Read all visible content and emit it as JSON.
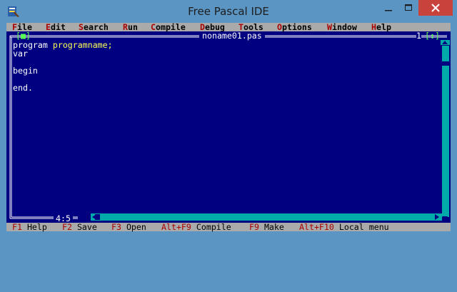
{
  "window": {
    "title": "Free Pascal IDE",
    "icon": "pascal-app-icon",
    "controls": [
      "minimize-icon",
      "maximize-icon",
      "close-icon"
    ],
    "accent_close": "#c7433b"
  },
  "menu": [
    {
      "hotkey": "F",
      "rest": "ile"
    },
    {
      "hotkey": "E",
      "rest": "dit"
    },
    {
      "hotkey": "S",
      "rest": "earch"
    },
    {
      "hotkey": "R",
      "rest": "un"
    },
    {
      "hotkey": "C",
      "rest": "ompile"
    },
    {
      "hotkey": "D",
      "rest": "ebug"
    },
    {
      "hotkey": "T",
      "rest": "ools"
    },
    {
      "hotkey": "O",
      "rest": "ptions"
    },
    {
      "hotkey": "W",
      "rest": "indow"
    },
    {
      "hotkey": "H",
      "rest": "elp"
    }
  ],
  "editor": {
    "filename": "noname01.pas",
    "window_number": "1",
    "close_box": "[■]",
    "zoom_box": "[↕]",
    "cursor_position": "4:5",
    "code": {
      "line1_keyword": "program",
      "line1_ident": "programname;",
      "line2": "var",
      "line4": "begin",
      "line6": "end."
    }
  },
  "status": [
    {
      "key": "F1",
      "label": "Help"
    },
    {
      "key": "F2",
      "label": "Save"
    },
    {
      "key": "F3",
      "label": "Open"
    },
    {
      "key": "Alt+F9",
      "label": "Compile"
    },
    {
      "key": "F9",
      "label": "Make"
    },
    {
      "key": "Alt+F10",
      "label": "Local menu"
    }
  ],
  "colors": {
    "desktop": "#000080",
    "bars": "#aaaaaa",
    "hotkey": "#aa0000",
    "identifier": "#ffff55",
    "frame_icons": "#55ff55"
  }
}
